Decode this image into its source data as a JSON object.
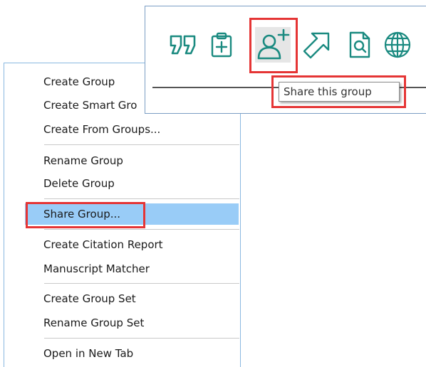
{
  "context_menu": {
    "items": [
      {
        "label": "Create Group"
      },
      {
        "label": "Create Smart Gro"
      },
      {
        "label": "Create From Groups..."
      },
      {
        "label": "Rename Group"
      },
      {
        "label": "Delete Group"
      },
      {
        "label": "Share Group..."
      },
      {
        "label": "Create Citation Report"
      },
      {
        "label": "Manuscript Matcher"
      },
      {
        "label": "Create Group Set"
      },
      {
        "label": "Rename Group Set"
      },
      {
        "label": "Open in New Tab"
      }
    ],
    "selected_item": "Share Group..."
  },
  "toolbar": {
    "icons": [
      {
        "name": "quote-icon"
      },
      {
        "name": "clipboard-add-icon"
      },
      {
        "name": "share-user-add-icon",
        "active": true
      },
      {
        "name": "arrow-up-right-icon"
      },
      {
        "name": "document-search-icon"
      },
      {
        "name": "globe-icon"
      }
    ],
    "icon_color": "#1a8a80",
    "tooltip": "Share this group"
  },
  "highlight_color": "#e53535",
  "selection_color": "#99ccf7"
}
